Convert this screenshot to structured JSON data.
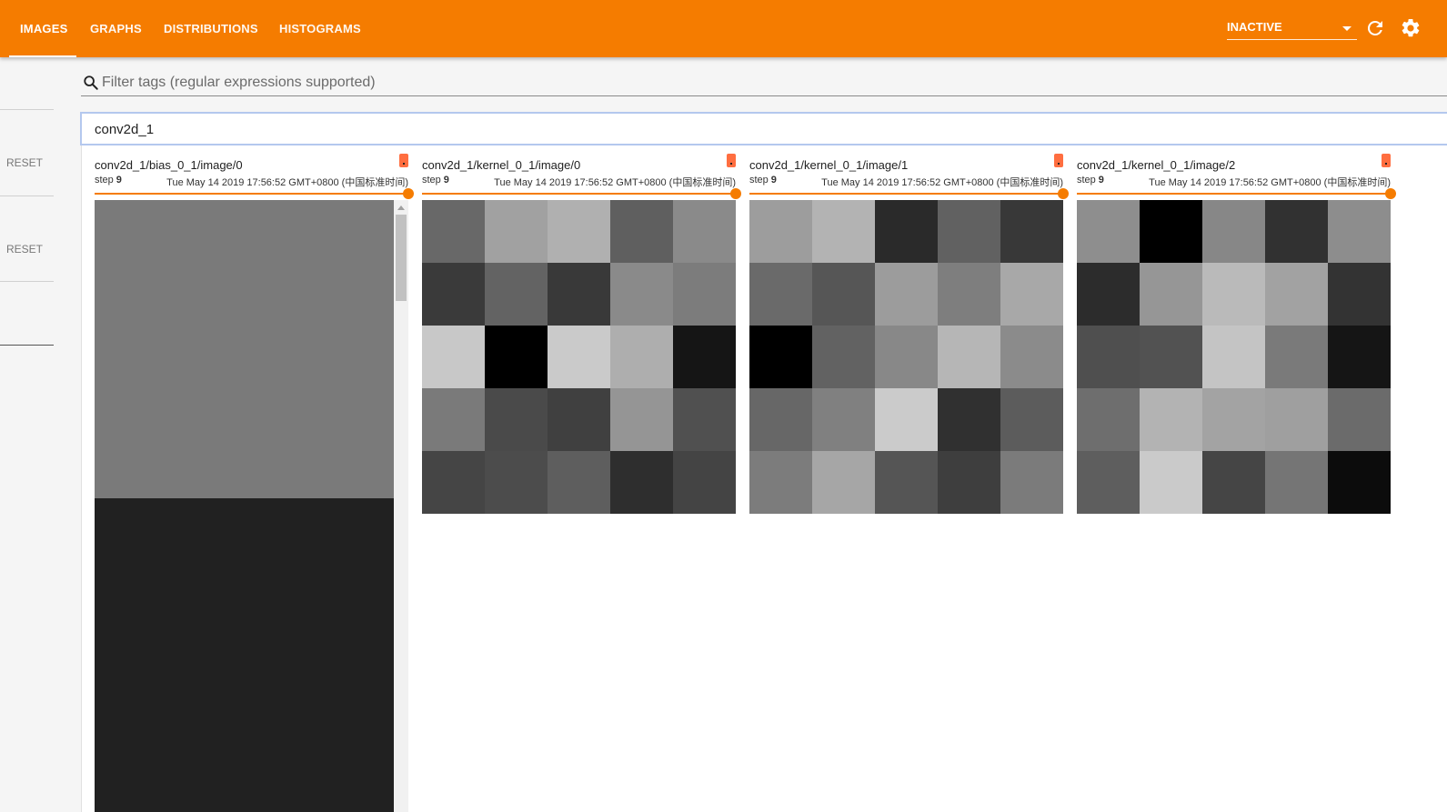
{
  "nav": {
    "tabs": [
      {
        "label": "IMAGES",
        "active": true
      },
      {
        "label": "GRAPHS",
        "active": false
      },
      {
        "label": "DISTRIBUTIONS",
        "active": false
      },
      {
        "label": "HISTOGRAMS",
        "active": false
      }
    ],
    "run_state": "INACTIVE",
    "accent_color": "#f57c00"
  },
  "sidebar": {
    "reset_labels": [
      "RESET",
      "RESET"
    ]
  },
  "filter": {
    "placeholder": "Filter tags (regular expressions supported)",
    "value": ""
  },
  "group": {
    "name": "conv2d_1"
  },
  "cards": [
    {
      "tag": "conv2d_1/bias_0_1/image/0",
      "step_label": "step",
      "step": "9",
      "timestamp": "Tue May 14 2019 17:56:52 GMT+0800 (中国标准时间)",
      "image_colors": [
        "#7a7a7a",
        "#212121"
      ]
    },
    {
      "tag": "conv2d_1/kernel_0_1/image/0",
      "step_label": "step",
      "step": "9",
      "timestamp": "Tue May 14 2019 17:56:52 GMT+0800 (中国标准时间)",
      "pixels": [
        "#686868",
        "#a1a1a1",
        "#b0b0b0",
        "#5f5f5f",
        "#8a8a8a",
        "#3a3a3a",
        "#636363",
        "#393939",
        "#8a8a8a",
        "#7c7c7c",
        "#c8c8c8",
        "#000000",
        "#cacaca",
        "#aeaeae",
        "#151515",
        "#7a7a7a",
        "#4a4a4a",
        "#404040",
        "#959595",
        "#505050",
        "#454545",
        "#4c4c4c",
        "#5e5e5e",
        "#2e2e2e",
        "#444444"
      ]
    },
    {
      "tag": "conv2d_1/kernel_0_1/image/1",
      "step_label": "step",
      "step": "9",
      "timestamp": "Tue May 14 2019 17:56:52 GMT+0800 (中国标准时间)",
      "pixels": [
        "#9d9d9d",
        "#b3b3b3",
        "#2a2a2a",
        "#616161",
        "#383838",
        "#6a6a6a",
        "#565656",
        "#9c9c9c",
        "#7e7e7e",
        "#a8a8a8",
        "#000000",
        "#626262",
        "#888888",
        "#b6b6b6",
        "#8b8b8b",
        "#676767",
        "#808080",
        "#cbcbcb",
        "#303030",
        "#5c5c5c",
        "#7c7c7c",
        "#a6a6a6",
        "#555555",
        "#3e3e3e",
        "#7b7b7b"
      ]
    },
    {
      "tag": "conv2d_1/kernel_0_1/image/2",
      "step_label": "step",
      "step": "9",
      "timestamp": "Tue May 14 2019 17:56:52 GMT+0800 (中国标准时间)",
      "pixels": [
        "#8e8e8e",
        "#000000",
        "#878787",
        "#313131",
        "#8d8d8d",
        "#2c2c2c",
        "#969696",
        "#bababa",
        "#a2a2a2",
        "#333333",
        "#4f4f4f",
        "#525252",
        "#c4c4c4",
        "#7a7a7a",
        "#151515",
        "#6e6e6e",
        "#b3b3b3",
        "#a3a3a3",
        "#9f9f9f",
        "#6b6b6b",
        "#5e5e5e",
        "#cacaca",
        "#454545",
        "#757575",
        "#0c0c0c"
      ]
    }
  ]
}
